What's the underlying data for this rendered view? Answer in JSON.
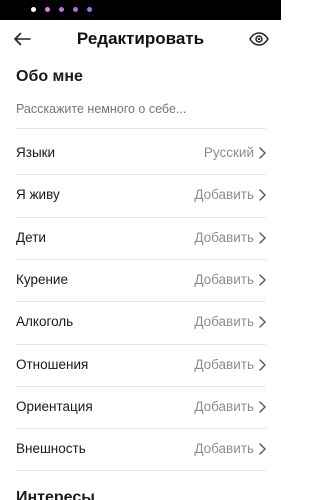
{
  "status_bar": {
    "dot_colors": [
      "#ffffff",
      "#e07de8",
      "#c86ae0",
      "#b766e3",
      "#a96be6"
    ]
  },
  "header": {
    "title": "Редактировать",
    "back_icon": "arrow-left-icon",
    "visibility_icon": "eye-icon"
  },
  "about": {
    "title": "Обо мне",
    "placeholder": "Расскажите немного о себе..."
  },
  "rows": [
    {
      "label": "Языки",
      "value": "Русский"
    },
    {
      "label": "Я живу",
      "value": "Добавить"
    },
    {
      "label": "Дети",
      "value": "Добавить"
    },
    {
      "label": "Курение",
      "value": "Добавить"
    },
    {
      "label": "Алкоголь",
      "value": "Добавить"
    },
    {
      "label": "Отношения",
      "value": "Добавить"
    },
    {
      "label": "Ориентация",
      "value": "Добавить"
    },
    {
      "label": "Внешность",
      "value": "Добавить"
    }
  ],
  "next_section": {
    "title": "Интересы"
  }
}
